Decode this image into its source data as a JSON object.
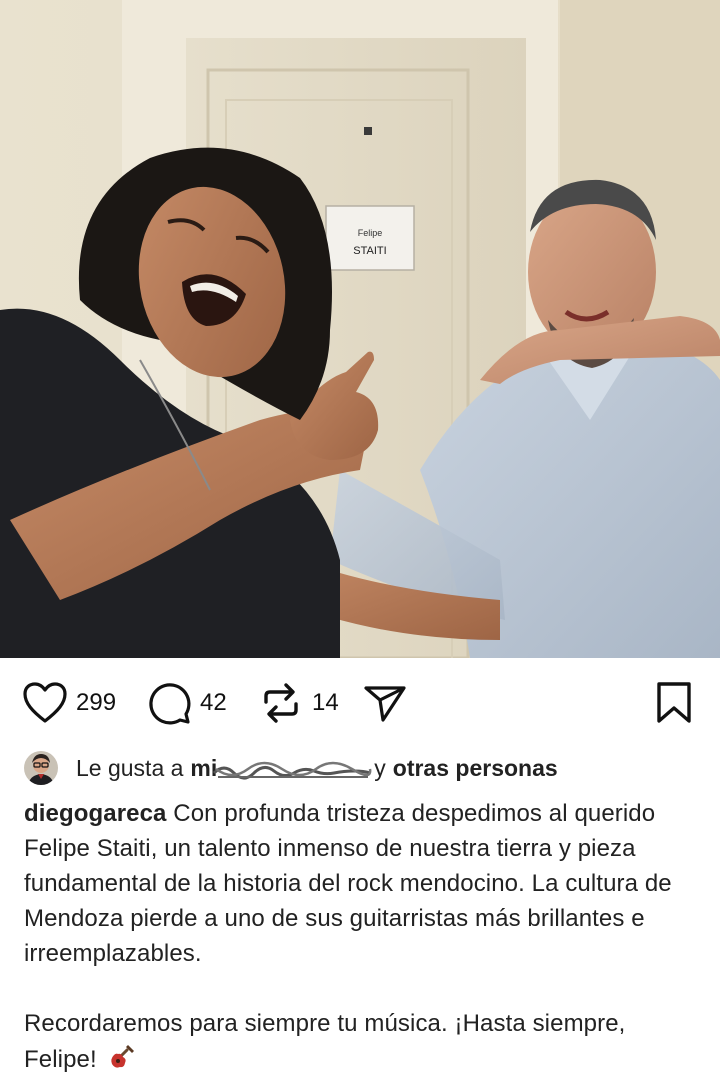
{
  "photo": {
    "door_sign": {
      "line1": "Felipe",
      "line2": "STAITI"
    }
  },
  "actions": {
    "like": {
      "icon": "heart-icon",
      "count": "299"
    },
    "comment": {
      "icon": "comment-bubble-icon",
      "count": "42"
    },
    "repost": {
      "icon": "repost-icon",
      "count": "14"
    },
    "share": {
      "icon": "send-icon"
    },
    "save": {
      "icon": "bookmark-icon"
    }
  },
  "likes": {
    "prefix": "Le gusta a",
    "user": "mi",
    "connector": "y",
    "rest": "otras personas"
  },
  "caption": {
    "author": "diegogareca",
    "text": "Con profunda tristeza despedimos al querido Felipe Staiti, un talento inmenso de nuestra tierra y pieza fundamental de la historia del rock mendocino. La cultura de Mendoza pierde a uno de sus guitarristas más brillantes e irreemplazables.",
    "closing": "Recordaremos para siempre tu música. ¡Hasta siempre, Felipe!",
    "emoji": "guitar-icon"
  },
  "colors": {
    "text": "#111111",
    "secondary": "#222222",
    "background": "#ffffff"
  }
}
